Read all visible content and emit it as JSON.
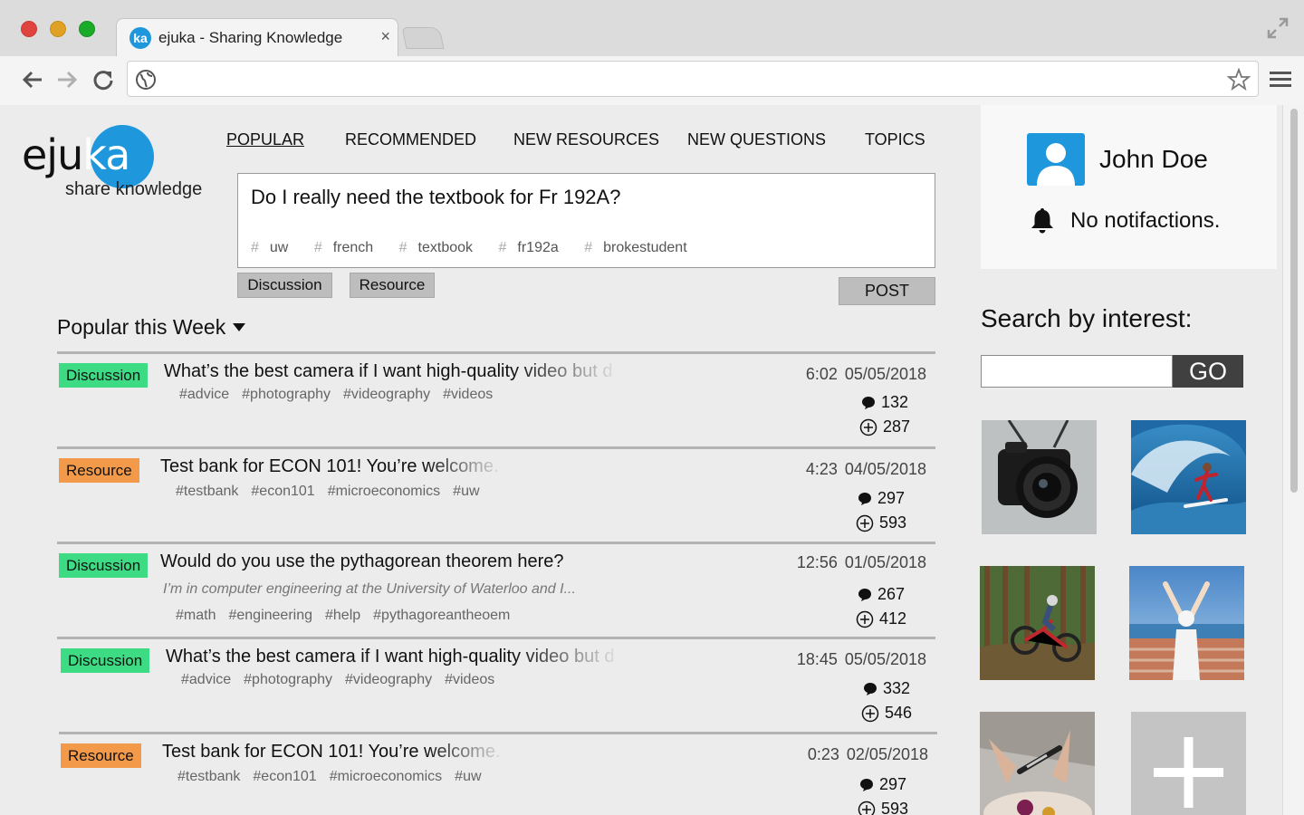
{
  "browser": {
    "tab_title": "ejuka - Sharing Knowledge",
    "tab_favicon": "ka",
    "tab_close": "×",
    "url": ""
  },
  "logo": {
    "word_a": "eju",
    "word_b": "ka",
    "tagline": "share knowledge"
  },
  "nav": [
    {
      "label": "POPULAR",
      "active": true
    },
    {
      "label": "RECOMMENDED",
      "active": false
    },
    {
      "label": "NEW RESOURCES",
      "active": false
    },
    {
      "label": "NEW QUESTIONS",
      "active": false
    },
    {
      "label": "TOPICS",
      "active": false
    }
  ],
  "composer": {
    "text": "Do I really need the textbook for Fr 192A?",
    "tags": [
      "uw",
      "french",
      "textbook",
      "fr192a",
      "brokestudent"
    ],
    "discussion_label": "Discussion",
    "resource_label": "Resource",
    "post_label": "POST"
  },
  "feed": {
    "title": "Popular this Week",
    "posts": [
      {
        "type": "Discussion",
        "title": "What’s the best camera if I want high-quality video but d",
        "excerpt": "",
        "tags": [
          "#advice",
          "#photography",
          "#videography",
          "#videos"
        ],
        "time": "6:02",
        "date": "05/05/2018",
        "comments": "132",
        "likes": "287"
      },
      {
        "type": "Resource",
        "title": "Test bank for ECON 101! You’re welcome.",
        "excerpt": "",
        "tags": [
          "#testbank",
          "#econ101",
          "#microeconomics",
          "#uw"
        ],
        "time": "4:23",
        "date": "04/05/2018",
        "comments": "297",
        "likes": "593"
      },
      {
        "type": "Discussion",
        "title": "Would do you use the pythagorean theorem here?",
        "excerpt": "I’m in computer engineering at the University of Waterloo and I...",
        "tags": [
          "#math",
          "#engineering",
          "#help",
          "#pythagoreantheoem"
        ],
        "time": "12:56",
        "date": "01/05/2018",
        "comments": "267",
        "likes": "412"
      },
      {
        "type": "Discussion",
        "title": "What’s the best camera if I want high-quality video but d",
        "excerpt": "",
        "tags": [
          "#advice",
          "#photography",
          "#videography",
          "#videos"
        ],
        "time": "18:45",
        "date": "05/05/2018",
        "comments": "332",
        "likes": "546"
      },
      {
        "type": "Resource",
        "title": "Test bank for ECON 101! You’re welcome.",
        "excerpt": "",
        "tags": [
          "#testbank",
          "#econ101",
          "#microeconomics",
          "#uw"
        ],
        "time": "0:23",
        "date": "02/05/2018",
        "comments": "297",
        "likes": "593"
      }
    ]
  },
  "sidebar": {
    "user_name": "John Doe",
    "notifications": "No notifactions.",
    "interest_title": "Search by interest:",
    "search_value": "",
    "go_label": "GO",
    "interests": [
      "camera-image",
      "surfing-image",
      "mountain-biking-image",
      "travel-image",
      "cooking-image",
      "add-interest"
    ]
  },
  "colors": {
    "brand": "#1f97dc",
    "discussion": "#3ddc84",
    "resource": "#f39a4a"
  }
}
